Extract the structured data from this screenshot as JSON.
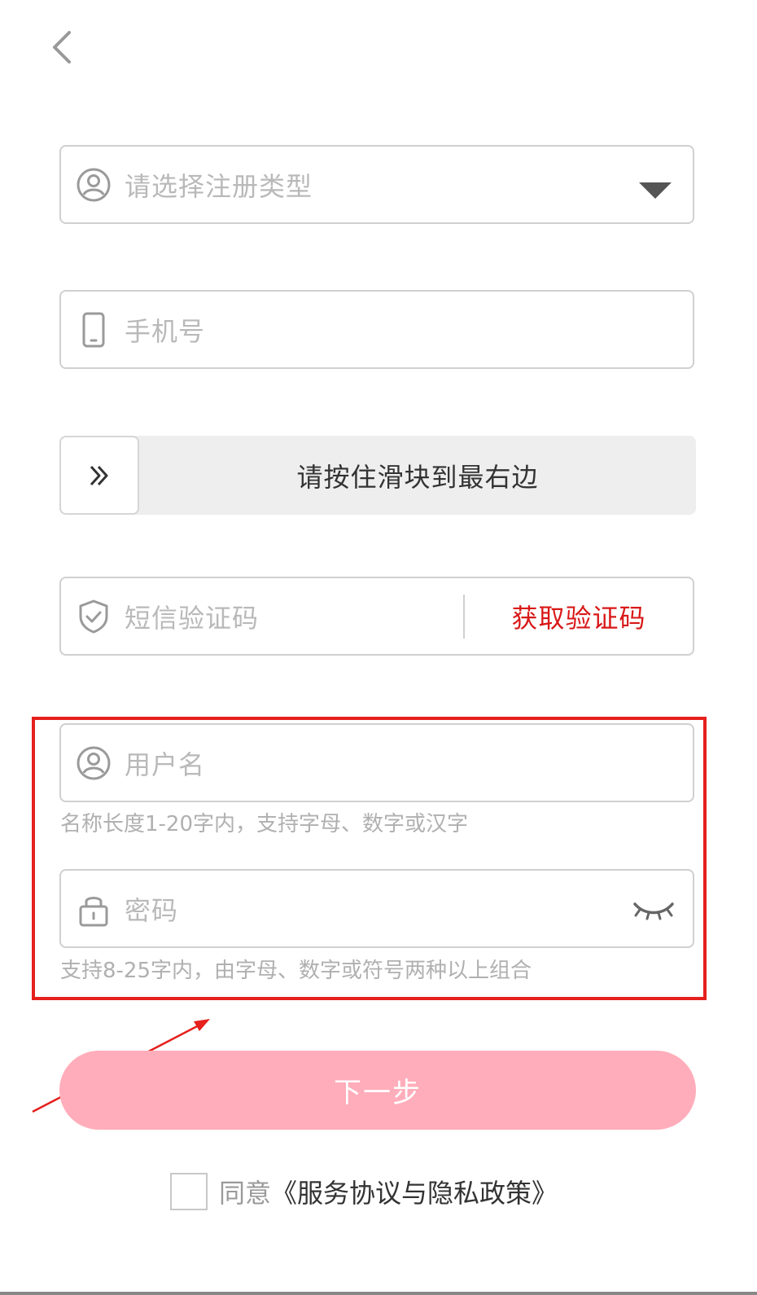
{
  "header": {
    "back_icon": "chevron-left-icon"
  },
  "form": {
    "type_select": {
      "placeholder": "请选择注册类型",
      "icon": "user-circle-icon"
    },
    "phone": {
      "placeholder": "手机号",
      "icon": "mobile-phone-icon"
    },
    "slider": {
      "label": "请按住滑块到最右边",
      "icon": "double-chevron-right-icon"
    },
    "sms": {
      "placeholder": "短信验证码",
      "icon": "shield-check-icon",
      "get_code_label": "获取验证码",
      "get_code_color": "#d91818"
    },
    "username": {
      "placeholder": "用户名",
      "icon": "user-circle-icon",
      "hint": "名称长度1-20字内，支持字母、数字或汉字"
    },
    "password": {
      "placeholder": "密码",
      "icon": "lock-icon",
      "toggle_icon": "eye-closed-icon",
      "hint": "支持8-25字内，由字母、数字或符号两种以上组合"
    }
  },
  "next_button": {
    "label": "下一步",
    "color": "#ffadba"
  },
  "agreement": {
    "prefix": "同意",
    "link": "《服务协议与隐私政策》",
    "checked": false
  },
  "annotation": {
    "highlight_color": "#e5201d"
  }
}
